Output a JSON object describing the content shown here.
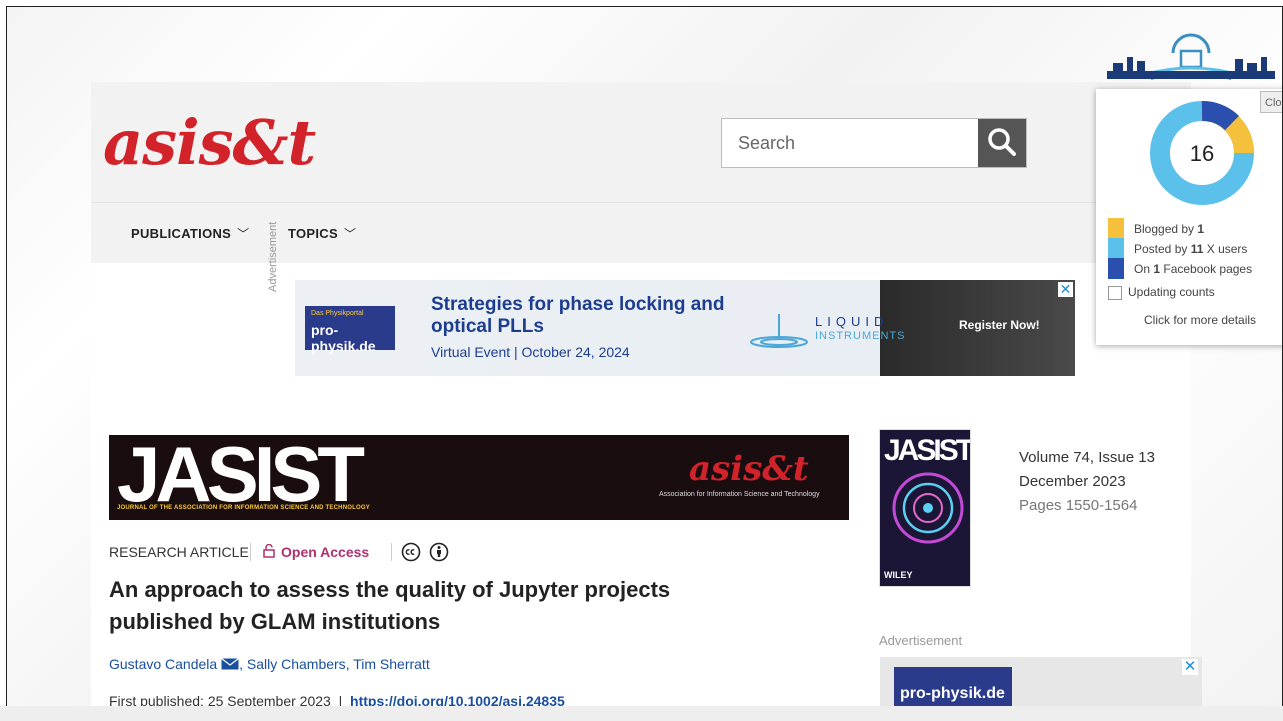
{
  "site": {
    "logo_text": "asis&t",
    "search_placeholder": "Search",
    "nav": [
      {
        "label": "PUBLICATIONS"
      },
      {
        "label": "TOPICS"
      }
    ]
  },
  "ad_top": {
    "label": "Advertisement",
    "brand": "pro-physik.de",
    "brand_small": "Das Physikportal",
    "headline": "Strategies for phase locking and optical PLLs",
    "subline": "Virtual Event | October 24, 2024",
    "partner": "LIQUID",
    "partner_sub": "INSTRUMENTS",
    "cta": "Register Now!",
    "close": "✕"
  },
  "journal_banner": {
    "title": "JASIST",
    "subtitle": "JOURNAL OF THE ASSOCIATION FOR INFORMATION SCIENCE AND TECHNOLOGY",
    "logo": "asis&t",
    "logo_sub": "Association for Information Science and Technology"
  },
  "article": {
    "type": "RESEARCH ARTICLE",
    "access": "Open Access",
    "title": "An approach to assess the quality of Jupyter projects published by GLAM institutions",
    "authors": [
      "Gustavo Candela",
      "Sally Chambers",
      "Tim Sherratt"
    ],
    "first_published_label": "First published:",
    "first_published_date": "25 September 2023",
    "doi": "https://doi.org/10.1002/asi.24835"
  },
  "issue": {
    "cover_title": "JASIST",
    "cover_publisher": "WILEY",
    "volume": "Volume 74, Issue 13",
    "date": "December 2023",
    "pages": "Pages 1550-1564"
  },
  "ad_side": {
    "label": "Advertisement",
    "brand": "pro-physik.de",
    "close": "✕"
  },
  "altmetric": {
    "score": "16",
    "close_label": "Clos",
    "legend": [
      {
        "pre": "Blogged by ",
        "count": "1",
        "post": "",
        "color": "#f5c13c"
      },
      {
        "pre": "Posted by ",
        "count": "11",
        "post": " X users",
        "color": "#5cc1ea"
      },
      {
        "pre": "On ",
        "count": "1",
        "post": " Facebook pages",
        "color": "#2b4fae"
      }
    ],
    "updating": "Updating counts",
    "more": "Click for more details"
  }
}
